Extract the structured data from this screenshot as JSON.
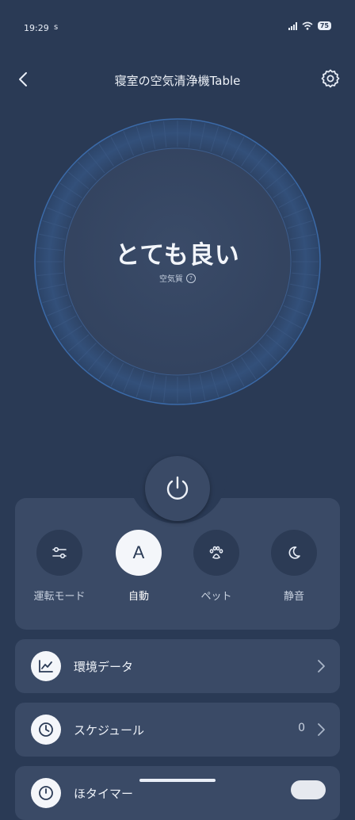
{
  "status_bar": {
    "time": "19:29",
    "carrier_mark": "s",
    "battery": "75"
  },
  "header": {
    "title": "寝室の空気清浄機Table",
    "back_icon": "chevron-left-icon",
    "settings_icon": "gear-icon"
  },
  "dial": {
    "status": "とても良い",
    "label": "空気質",
    "help": "?"
  },
  "controls": {
    "power_icon": "power-icon",
    "modes": [
      {
        "label": "運転モード",
        "icon": "sliders-icon",
        "active": false
      },
      {
        "label": "自動",
        "icon": "A",
        "active": true
      },
      {
        "label": "ペット",
        "icon": "paw-icon",
        "active": false
      },
      {
        "label": "静音",
        "icon": "moon-icon",
        "active": false
      }
    ]
  },
  "list": [
    {
      "label": "環境データ",
      "icon": "chart-icon",
      "value": ""
    },
    {
      "label": "スケジュール",
      "icon": "clock-icon",
      "value": "0"
    },
    {
      "label": "ほタイマー",
      "icon": "timer-icon",
      "value": ""
    }
  ],
  "colors": {
    "background": "#2a3a55",
    "card": "#3a4a66",
    "accent_ring": "#3a78c8"
  }
}
